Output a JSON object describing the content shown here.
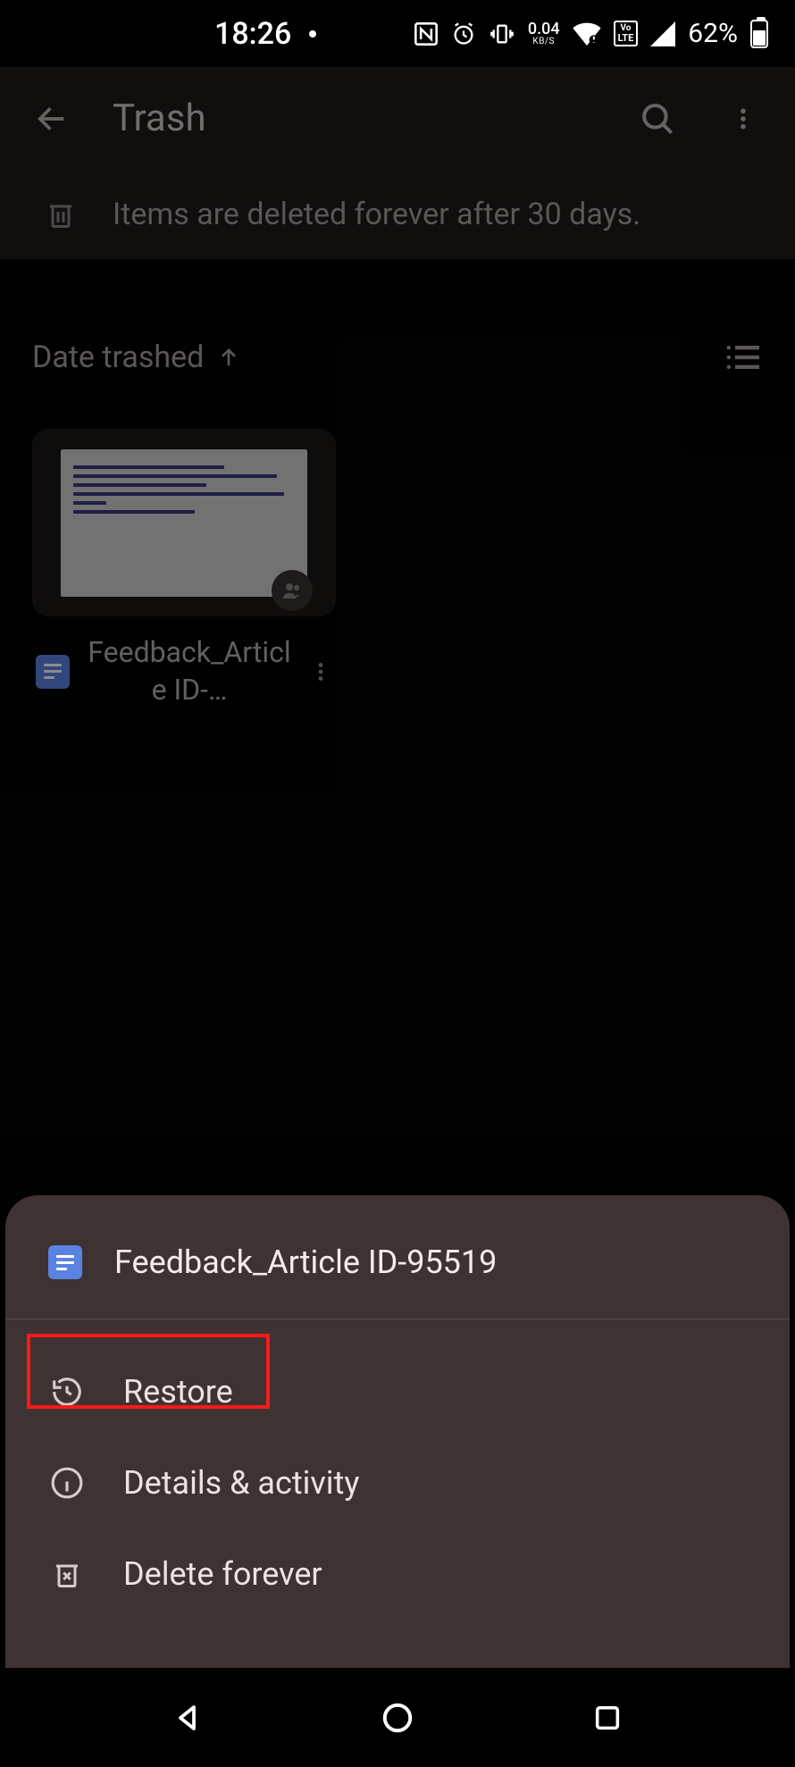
{
  "status": {
    "time": "18:26",
    "net_rate_top": "0.04",
    "net_rate_bottom": "KB/S",
    "lte_top": "Vo",
    "lte_bottom": "LTE",
    "battery_pct": "62%"
  },
  "appbar": {
    "title": "Trash"
  },
  "notice": {
    "text": "Items are deleted forever after 30 days."
  },
  "sort": {
    "label": "Date trashed"
  },
  "files": [
    {
      "name": "Feedback_Article ID-…"
    }
  ],
  "sheet": {
    "title": "Feedback_Article ID-95519",
    "items": {
      "restore": "Restore",
      "details": "Details & activity",
      "delete": "Delete forever"
    }
  }
}
